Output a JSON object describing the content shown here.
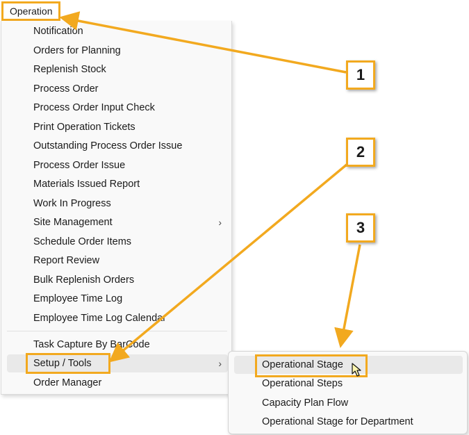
{
  "menu_bar": {
    "title": "Operation"
  },
  "main_menu": {
    "items": [
      {
        "label": "Notification"
      },
      {
        "label": "Orders for Planning"
      },
      {
        "label": "Replenish Stock"
      },
      {
        "label": "Process Order"
      },
      {
        "label": "Process Order Input Check"
      },
      {
        "label": "Print Operation Tickets"
      },
      {
        "label": "Outstanding Process Order Issue"
      },
      {
        "label": "Process Order Issue"
      },
      {
        "label": "Materials Issued Report"
      },
      {
        "label": "Work In Progress"
      },
      {
        "label": "Site Management",
        "submenu": true
      },
      {
        "label": "Schedule Order Items"
      },
      {
        "label": "Report Review"
      },
      {
        "label": "Bulk Replenish Orders"
      },
      {
        "label": "Employee Time Log"
      },
      {
        "label": "Employee Time Log Calendar"
      }
    ],
    "items_after_separator": [
      {
        "label": "Task Capture By BarCode"
      },
      {
        "label": "Setup / Tools",
        "submenu": true,
        "highlighted": true
      },
      {
        "label": "Order Manager"
      }
    ],
    "chevron": "›"
  },
  "sub_menu": {
    "items": [
      {
        "label": "Operational Stage",
        "highlighted": true
      },
      {
        "label": "Operational Steps"
      },
      {
        "label": "Capacity Plan Flow"
      },
      {
        "label": "Operational Stage for Department"
      }
    ]
  },
  "callouts": [
    {
      "number": "1"
    },
    {
      "number": "2"
    },
    {
      "number": "3"
    }
  ],
  "colors": {
    "accent": "#f2a91f",
    "menu_bg": "#f9f9f9",
    "hover_bg": "#e9e9e9"
  }
}
